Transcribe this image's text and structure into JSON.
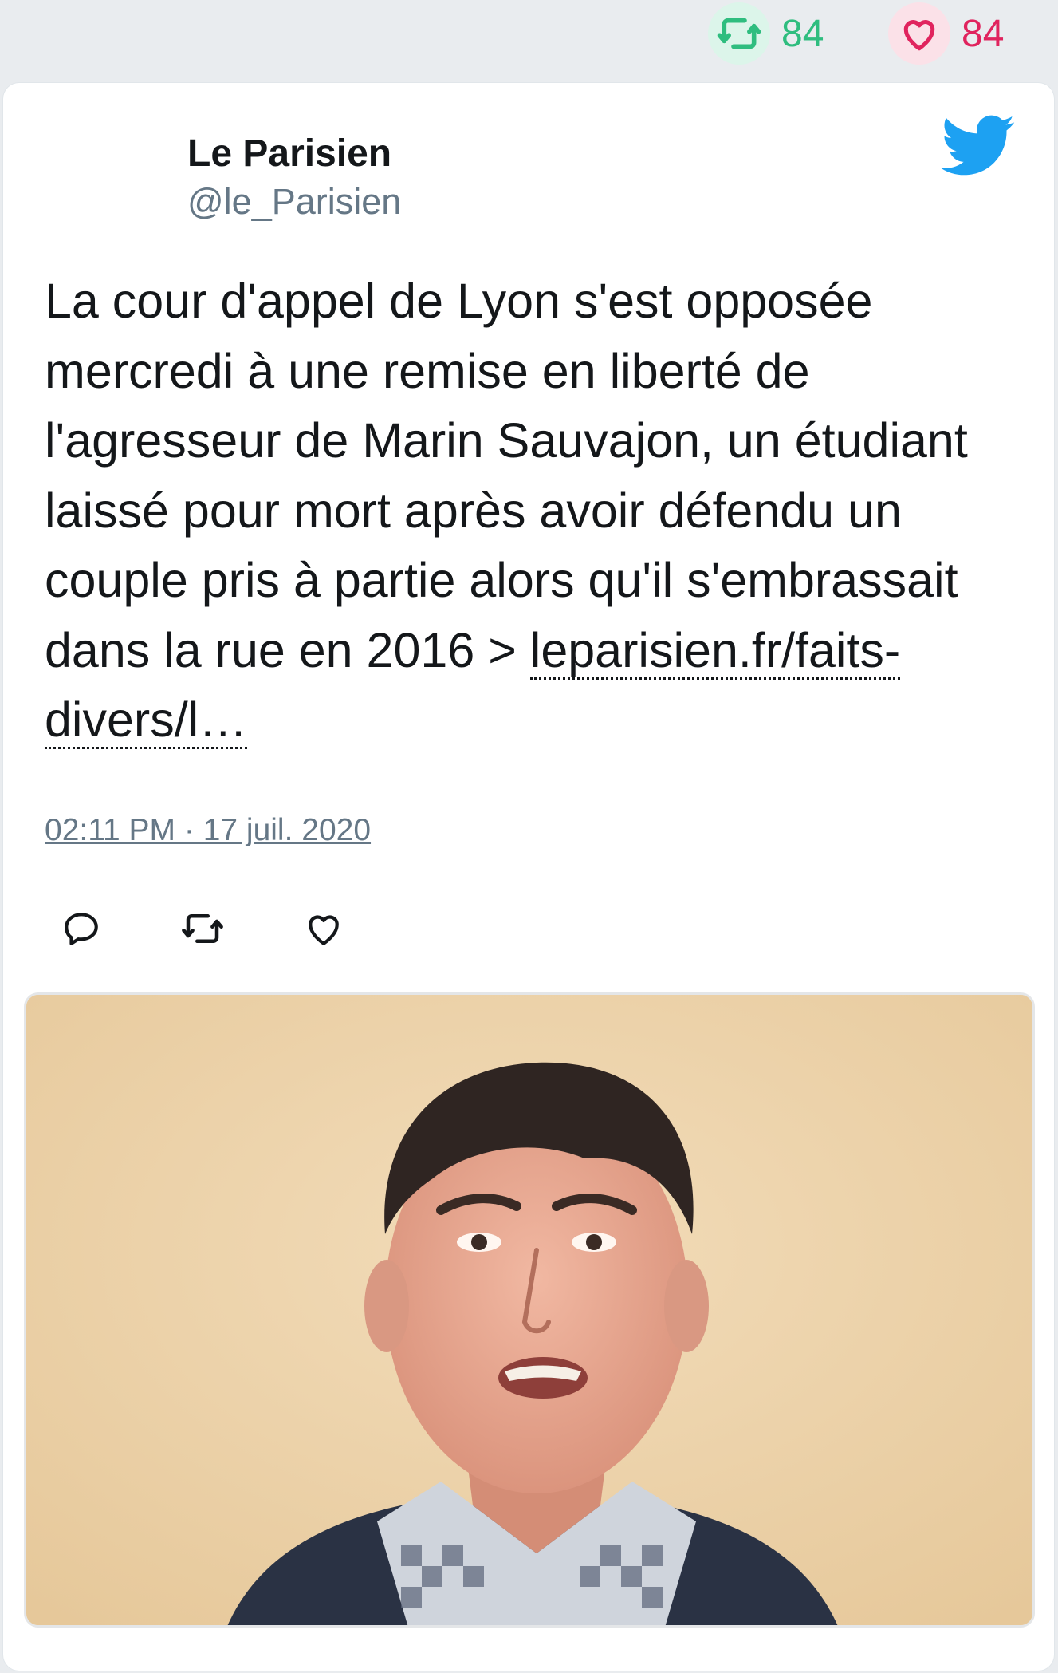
{
  "stats": {
    "retweets": "84",
    "likes": "84",
    "retweet_color": "#2fbd7f",
    "like_color": "#e0245e"
  },
  "tweet": {
    "author_name": "Le Parisien",
    "author_handle": "@le_Parisien",
    "text": "La cour d'appel de Lyon s'est opposée mercredi à une remise en liberté de l'agresseur de Marin Sauvajon, un étudiant laissé pour mort après avoir défendu un couple pris à partie alors qu'il s'embrassait dans la rue en 2016 > ",
    "link_text": "leparisien.fr/faits-divers/l…",
    "timestamp": "02:11 PM · 17 juil. 2020",
    "brand_color": "#1da1f2"
  },
  "icons": {
    "retweet": "retweet-icon",
    "like": "heart-icon",
    "reply": "reply-icon",
    "logo": "twitter-bird-icon"
  }
}
